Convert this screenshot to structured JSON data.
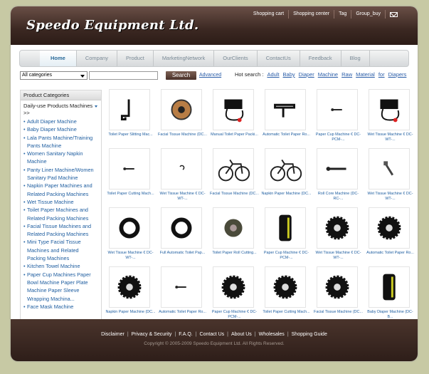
{
  "header": {
    "logo": "Speedo Equipment Ltd.",
    "links": [
      "Shopping cart",
      "Shopping center",
      "Tag",
      "Group_buy"
    ],
    "mail_icon": "mail-icon"
  },
  "nav": [
    "Home",
    "Company",
    "Product",
    "MarketingNetwork",
    "OurClients",
    "ContactUs",
    "Feedback",
    "Blog"
  ],
  "search": {
    "category": "All categories",
    "query": "",
    "button": "Search",
    "advanced": "Advanced",
    "hot_label": "Hot search :",
    "hot_keywords": [
      "Adult",
      "Baby",
      "Diaper",
      "Machine",
      "Raw",
      "Material",
      "for",
      "Diapers"
    ]
  },
  "sidebar": {
    "heading": "Product Categories",
    "subheading": "Daily-use Products Machines >>",
    "items": [
      "Adult Diaper Machine",
      "Baby Diaper Machine",
      "Lala Pants Machine/Training Pants Machine",
      "Women Sanitary Napkin Machine",
      "Panty Liner Machine/Women Sanitary Pad Machine",
      "Napkin Paper Machines and Related Packing Machines",
      "Wet Tissue Machine",
      "Toilet Paper Machines and Related Packing Machines",
      "Facial Tissue Machines and Related Packing Machines",
      "Mini Type Facial Tissue Machines and Related Packing Machines",
      "Kitchen Towel Machine",
      "Paper Cup Machines Paper Bowl Machine Paper Plate Machine Paper Sleeve Wrapping Machina...",
      "Face Mask Machine"
    ]
  },
  "products": [
    {
      "caption": "Toilet Paper Slitting Mac...",
      "icon": "slitter-part"
    },
    {
      "caption": "Facial Tissue Machine (DC...",
      "icon": "gear-roll"
    },
    {
      "caption": "Manual Toilet Paper Packi...",
      "icon": "cable-device"
    },
    {
      "caption": "Automatic Toilet Paper Ro...",
      "icon": "bracket-part"
    },
    {
      "caption": "Paper Cup Machine € DC-PCM-...",
      "icon": "small-pin"
    },
    {
      "caption": "Wet Tissue Machine € DC-WT-...",
      "icon": "cable-device"
    },
    {
      "caption": "Toilet Paper Cutting Mach...",
      "icon": "small-pin"
    },
    {
      "caption": "Wet Tissue Machine € DC-WT-...",
      "icon": "clip-part"
    },
    {
      "caption": "Facial Tissue Machine (DC...",
      "icon": "bicycle"
    },
    {
      "caption": "Napkin Paper Machine (DC...",
      "icon": "bicycle"
    },
    {
      "caption": "Roll Core Machine (DC-RC-...",
      "icon": "rod-part"
    },
    {
      "caption": "Wet Tissue Machine € DC-WT-...",
      "icon": "screw-part"
    },
    {
      "caption": "Wet Tissue Machine € DC-WT-...",
      "icon": "ring"
    },
    {
      "caption": "Full Automatic Toilet Pap...",
      "icon": "ring"
    },
    {
      "caption": "Toilet Paper Roll Cutting...",
      "icon": "disc"
    },
    {
      "caption": "Paper Cup Machine € DC-PCM-...",
      "icon": "cylinder-part"
    },
    {
      "caption": "Wet Tissue Machine € DC-WT-...",
      "icon": "gear-wheel"
    },
    {
      "caption": "Automatic Toilet Paper Ro...",
      "icon": "gear-wheel"
    },
    {
      "caption": "Napkin Paper Machine (DC...",
      "icon": "gear-wheel"
    },
    {
      "caption": "Automatic Toilet Paper Ro...",
      "icon": "small-pin"
    },
    {
      "caption": "Paper Cup Machine € DC-PCM-...",
      "icon": "gear-wheel"
    },
    {
      "caption": "Toilet Paper Cutting Mach...",
      "icon": "gear-wheel"
    },
    {
      "caption": "Facial Tissue Machine (DC...",
      "icon": "gear-wheel"
    },
    {
      "caption": "Baby Diaper Machine (DC-B...",
      "icon": "cylinder-part"
    }
  ],
  "footer": {
    "links": [
      "Disclaimer",
      "Privacy & Security",
      "F.A.Q.",
      "Contact Us",
      "About Us",
      "Wholesales",
      "Shopping Guide"
    ],
    "copyright": "Copyright © 2005-2009 Speedo Equipment Ltd. All Rights Reserved."
  },
  "colors": {
    "brand_dark": "#3b2822",
    "link": "#1f5ea0",
    "page_bg": "#c7c9a4"
  }
}
